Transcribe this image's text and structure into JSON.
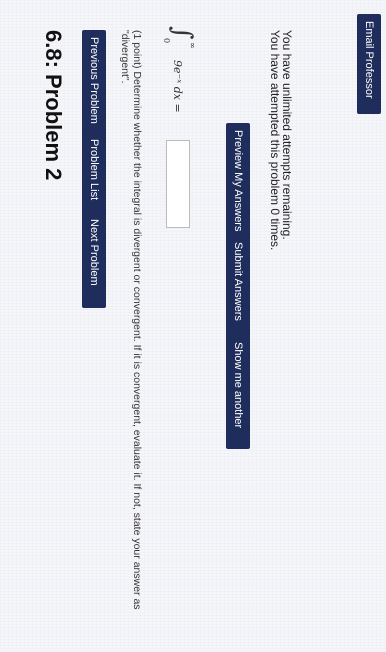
{
  "problem": {
    "title": "6.8: Problem 2",
    "text": "(1 point) Determine whether the integral is divergent or convergent. If it is convergent, evaluate it. If not, state your answer as \"divergent\".",
    "integral": {
      "upper": "∞",
      "lower": "0",
      "expression": "9e⁻ˣ dx ="
    },
    "answer_value": ""
  },
  "nav": {
    "previous": "Previous Problem",
    "list": "Problem List",
    "next": "Next Problem"
  },
  "actions": {
    "preview": "Preview My Answers",
    "submit": "Submit Answers",
    "show": "Show me another"
  },
  "status": {
    "attempts": "You have attempted this problem 0 times.",
    "remaining": "You have unlimited attempts remaining."
  },
  "email": {
    "label": "Email Professor"
  }
}
